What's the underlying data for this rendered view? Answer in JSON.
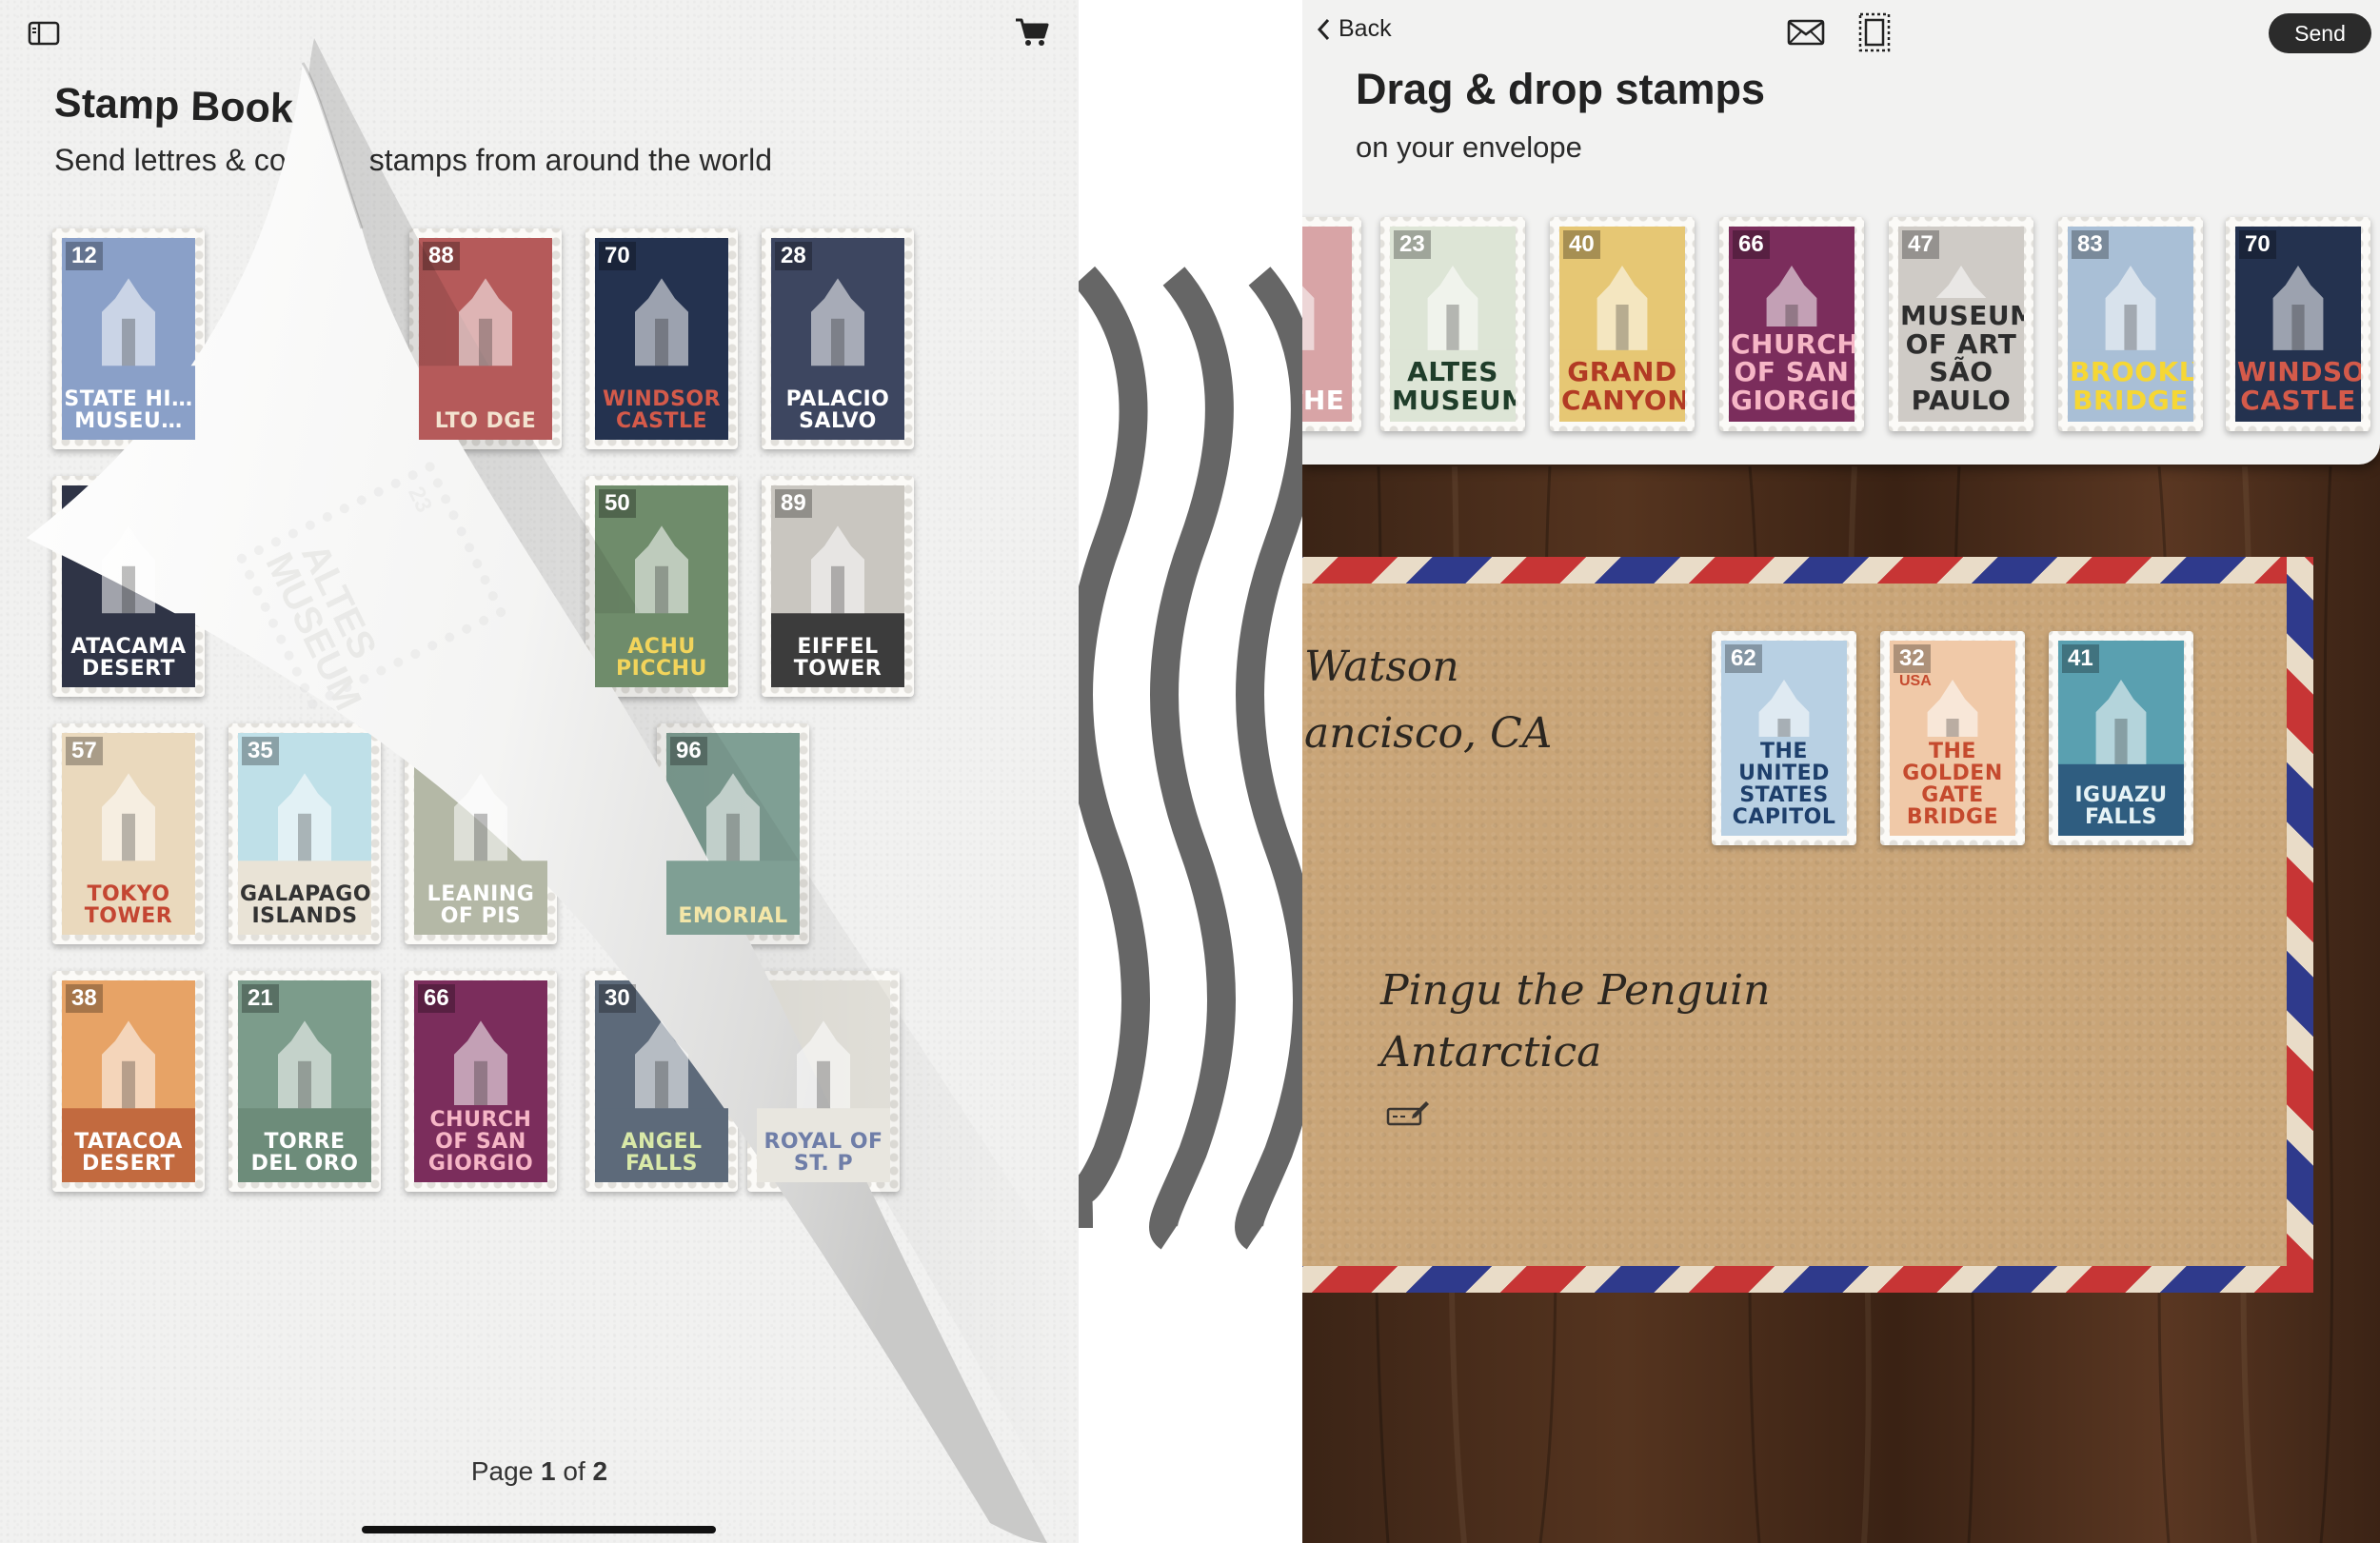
{
  "left_panel": {
    "title": "Stamp Book",
    "subtitle_part1": "Send lettres & colle",
    "subtitle_part2": "stamps from around the world",
    "page_label": "Page",
    "page_current": "1",
    "page_of": "of",
    "page_total": "2",
    "stamps": [
      {
        "num": "12",
        "name": "STATE HI… MUSEU…",
        "bg": "#8aa0c8",
        "band": "#8aa0c8",
        "text": "#ffffff"
      },
      {
        "num": "88",
        "name": "LTO DGE",
        "bg": "#b55a5a",
        "band": "#b55a5a",
        "text": "#f3e3d0"
      },
      {
        "num": "70",
        "name": "WINDSOR CASTLE",
        "bg": "#24324f",
        "band": "#24324f",
        "text": "#d45a4a"
      },
      {
        "num": "28",
        "name": "PALACIO SALVO",
        "bg": "#3d4660",
        "band": "#3d4660",
        "text": "#ffffff"
      },
      {
        "num": "50",
        "name": "ACHU PICCHU",
        "bg": "#6f8c6b",
        "band": "#6f8c6b",
        "text": "#f2d45b"
      },
      {
        "num": "89",
        "name": "EIFFEL TOWER",
        "bg": "#c9c6c0",
        "band": "#3c3c3c",
        "text": "#ffffff"
      },
      {
        "num": "",
        "name": "ATACAMA DESERT",
        "bg": "#2f3446",
        "band": "#2f3446",
        "text": "#ffffff"
      },
      {
        "num": "57",
        "name": "TOKYO TOWER",
        "bg": "#ead9bd",
        "band": "#ead9bd",
        "text": "#c44632"
      },
      {
        "num": "35",
        "name": "GALAPAGOS ISLANDS",
        "bg": "#bfe0e8",
        "band": "#e9e3d6",
        "text": "#333333"
      },
      {
        "num": "96",
        "name": "EMORIAL",
        "bg": "#7f9f94",
        "band": "#7f9f94",
        "text": "#f3e6a8"
      },
      {
        "num": "",
        "name": "LEANING OF PIS",
        "bg": "#b4b8a6",
        "band": "#b4b8a6",
        "text": "#ffffff"
      },
      {
        "num": "38",
        "name": "TATACOA DESERT",
        "bg": "#e7a366",
        "band": "#c26a3f",
        "text": "#ffffff"
      },
      {
        "num": "21",
        "name": "TORRE DEL ORO",
        "bg": "#7c9c8b",
        "band": "#6d8c7a",
        "text": "#ffffff"
      },
      {
        "num": "66",
        "name": "CHURCH OF SAN GIORGIO",
        "bg": "#7b2d5c",
        "band": "#7b2d5c",
        "text": "#f6b6c6"
      },
      {
        "num": "30",
        "name": "ANGEL FALLS",
        "bg": "#5d6a7a",
        "band": "#5d6a7a",
        "text": "#d9e9a8"
      },
      {
        "num": "",
        "name": "ROYAL OF ST. P",
        "bg": "#e8e6df",
        "band": "#e8e6df",
        "text": "#6f7ea8"
      },
      {
        "num": "23",
        "name": "ALTES MUSEUM",
        "bg": "#e2e6d8",
        "band": "#e2e6d8",
        "text": "#d1d1cd"
      }
    ]
  },
  "right_panel": {
    "back_label": "Back",
    "send_label": "Send",
    "title": "Drag & drop stamps",
    "subtitle": "on your envelope",
    "tray_stamps": [
      {
        "num": "",
        "name": "DE THE",
        "bg": "#d8a4a6",
        "band": "#d8a4a6",
        "text": "#ffffff"
      },
      {
        "num": "23",
        "name": "ALTES MUSEUM",
        "bg": "#dde5d6",
        "band": "#dde5d6",
        "text": "#1f3d2a"
      },
      {
        "num": "40",
        "name": "GRAND CANYON",
        "bg": "#e6c774",
        "band": "#e6c774",
        "text": "#b23a24"
      },
      {
        "num": "66",
        "name": "CHURCH OF SAN GIORGIO",
        "bg": "#7b2d5c",
        "band": "#7b2d5c",
        "text": "#f6b6c6"
      },
      {
        "num": "47",
        "name": "MUSEUM OF ART SÃO PAULO",
        "bg": "#cfcbc6",
        "band": "#cfcbc6",
        "text": "#2d2d2d"
      },
      {
        "num": "83",
        "name": "BROOKLYN BRIDGE",
        "bg": "#a9bfd6",
        "band": "#a9bfd6",
        "text": "#f6d735"
      },
      {
        "num": "70",
        "name": "WINDSOR CASTLE",
        "bg": "#24324f",
        "band": "#24324f",
        "text": "#d45a4a"
      }
    ],
    "envelope": {
      "sender_line1": "Watson",
      "sender_line2": "ancisco, CA",
      "recipient_line1": "Pingu the Penguin",
      "recipient_line2": "Antarctica",
      "stamps": [
        {
          "num": "62",
          "name": "THE UNITED STATES CAPITOL",
          "bg": "#b8d0e3",
          "band": "#b8d0e3",
          "text": "#1e3f6b"
        },
        {
          "num": "32",
          "sub": "USA",
          "name": "THE GOLDEN GATE BRIDGE",
          "bg": "#f0c9a8",
          "band": "#f0c9a8",
          "text": "#c54a2e"
        },
        {
          "num": "41",
          "name": "IGUAZU FALLS",
          "bg": "#5aa0b0",
          "band": "#2f5d80",
          "text": "#e5f2f5"
        }
      ]
    }
  },
  "colors": {
    "accent_dark": "#2b2b2b",
    "separator_squiggle": "#666666",
    "airmail_red": "#c73535",
    "airmail_blue": "#2f3a8c",
    "envelope_kraft": "#c9a578"
  }
}
